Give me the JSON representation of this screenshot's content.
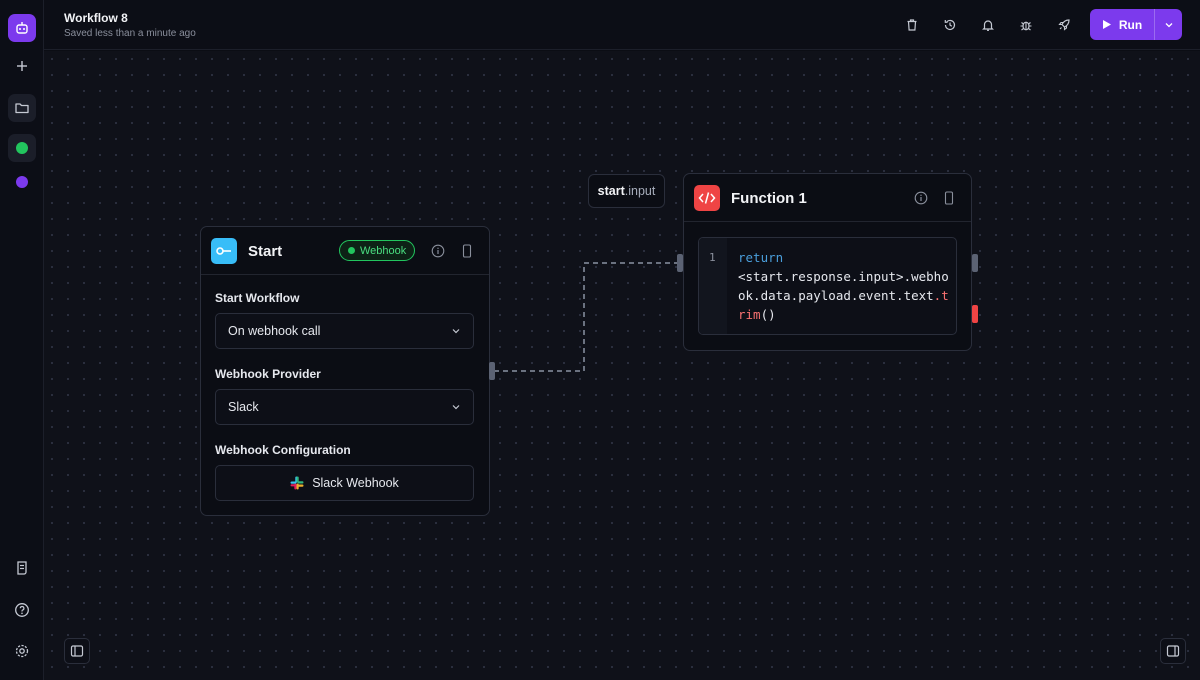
{
  "workflow": {
    "title": "Workflow 8",
    "saved_status": "Saved less than a minute ago"
  },
  "toolbar": {
    "icons": [
      "trash-icon",
      "history-icon",
      "bell-icon",
      "bug-icon",
      "rocket-icon"
    ],
    "run_label": "Run"
  },
  "sidebar": {
    "icons": [
      "logo-robot-icon",
      "plus-icon",
      "folder-icon",
      "workspace-green",
      "workspace-purple",
      "logs-icon",
      "help-icon",
      "settings-icon"
    ],
    "workspace_colors": [
      "#22c55e",
      "#7c3aed"
    ]
  },
  "start_node": {
    "title": "Start",
    "badge": "Webhook",
    "start_workflow_label": "Start Workflow",
    "start_workflow_value": "On webhook call",
    "provider_label": "Webhook Provider",
    "provider_value": "Slack",
    "config_label": "Webhook Configuration",
    "config_button": "Slack Webhook"
  },
  "connection_tag": {
    "block": "start",
    "field": ".input"
  },
  "function_node": {
    "title": "Function 1",
    "line_number": "1",
    "code_keyword": "return",
    "code_body": "<start.response.input>.webhook.data.payload.event.text",
    "code_method": ".trim",
    "code_parens": "()"
  },
  "colors": {
    "accent": "#7c3aed",
    "start_icon_bg": "#38bdf8",
    "function_icon_bg": "#ef4444",
    "badge_green": "#22c55e"
  }
}
